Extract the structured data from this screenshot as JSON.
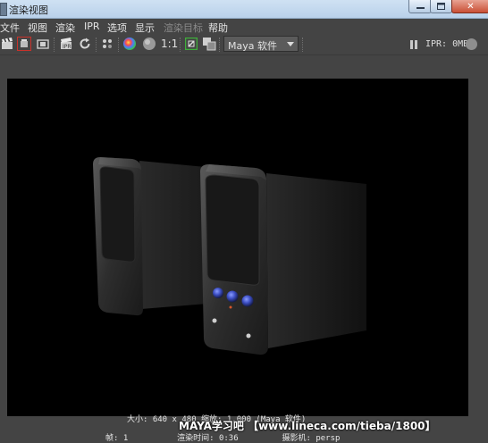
{
  "window": {
    "title": "渲染视图",
    "min_glyph": "▁",
    "close_glyph": "✕"
  },
  "menu": [
    {
      "label": "文件",
      "enabled": true
    },
    {
      "label": "视图",
      "enabled": true
    },
    {
      "label": "渲染",
      "enabled": true
    },
    {
      "label": "IPR",
      "enabled": true
    },
    {
      "label": "选项",
      "enabled": true
    },
    {
      "label": "显示",
      "enabled": true
    },
    {
      "label": "渲染目标",
      "enabled": false
    },
    {
      "label": "帮助",
      "enabled": true
    }
  ],
  "toolbar": {
    "icons": [
      "clapperboard-icon",
      "render-region-icon",
      "snapshot-icon",
      "ipr-render-icon",
      "refresh-icon",
      "render-settings-icon",
      "rgb-channel-icon",
      "alpha-channel-icon",
      "real-size-icon",
      "keep-image-icon",
      "remove-image-icon"
    ],
    "ratio_label": "1:1",
    "renderer": {
      "selected": "Maya 软件"
    },
    "ipr_memory": "IPR: 0MB"
  },
  "colors": {
    "panel": "#444444",
    "render_bg": "#000000",
    "accent_red": "#c8322b",
    "accent_green": "#3fae3b",
    "knob_blue": "#3d4fc4",
    "led_orange": "#d6562a"
  },
  "render_info": {
    "size_label": "大小:",
    "size_value": "640 x 480",
    "zoom_label": "缩放:",
    "zoom_value": "1.000",
    "renderer": "(Maya 软件)",
    "frame_label": "帧:",
    "frame_value": "1",
    "time_label": "渲染时间:",
    "time_value": "0:36",
    "camera_label": "摄影机:",
    "camera_value": "persp"
  },
  "watermark": "MAYA学习吧 【www.lineca.com/tieba/1800】"
}
